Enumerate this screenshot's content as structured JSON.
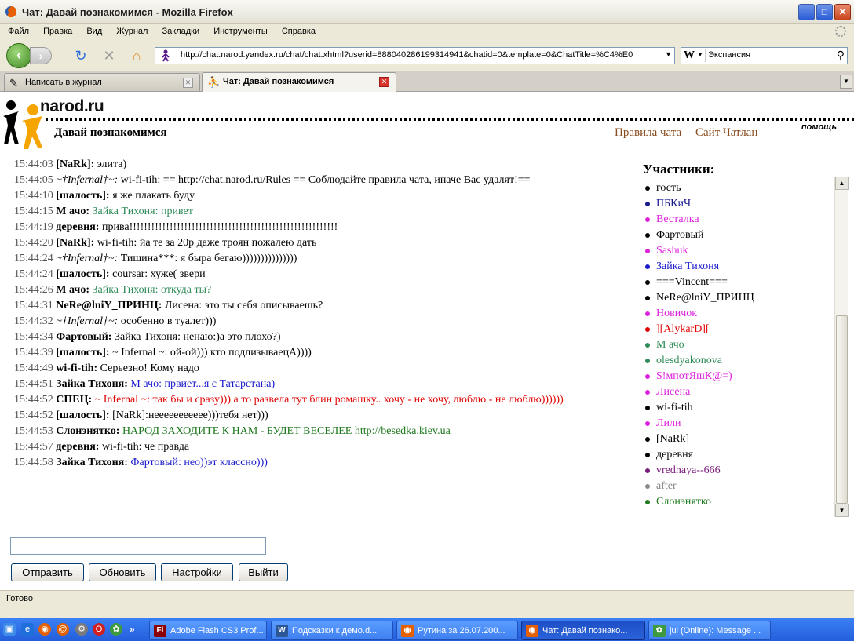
{
  "window": {
    "title": "Чат: Давай познакомимся - Mozilla Firefox"
  },
  "menu": [
    "Файл",
    "Правка",
    "Вид",
    "Журнал",
    "Закладки",
    "Инструменты",
    "Справка"
  ],
  "nav": {
    "url": "http://chat.narod.yandex.ru/chat/chat.xhtml?userid=888040286199314941&chatid=0&template=0&ChatTitle=%C4%E0",
    "search_engine": "W",
    "search_query": "Экспансия"
  },
  "tabs": [
    {
      "label": "Написать в журнал"
    },
    {
      "label": "Чат: Давай познакомимся"
    }
  ],
  "page": {
    "logo_text": "narod.ru",
    "help": "помощь",
    "room_title": "Давай познакомимся",
    "rules_link": "Правила чата",
    "site_link": "Сайт Чатлан",
    "participants_title": "Участники:"
  },
  "messages": [
    {
      "time": "15:44:03",
      "nick": "[NaRk]:",
      "text": " элита)",
      "color": "#000000"
    },
    {
      "time": "15:44:05",
      "nick": "~†Infernal†~:",
      "italic": true,
      "text": " wi-fi-tih: == http://chat.narod.ru/Rules == Соблюдайте правила чата, иначе Вас удалят!==",
      "color": "#000000"
    },
    {
      "time": "15:44:10",
      "nick": "[шалость]:",
      "text": " я же плакать буду",
      "color": "#000000"
    },
    {
      "time": "15:44:15",
      "nick": "М ачо:",
      "text": " Зайка Тихоня: привет",
      "color": "#2E8B57"
    },
    {
      "time": "15:44:19",
      "nick": "деревня:",
      "text": " прива!!!!!!!!!!!!!!!!!!!!!!!!!!!!!!!!!!!!!!!!!!!!!!!!!!!!!!!!!",
      "color": "#000000"
    },
    {
      "time": "15:44:20",
      "nick": "[NaRk]:",
      "text": " wi-fi-tih: йа те за 20р даже троян пожалею дать",
      "color": "#000000"
    },
    {
      "time": "15:44:24",
      "nick": "~†Infernal†~:",
      "italic": true,
      "text": " Тишина***: я быра бегаю)))))))))))))))",
      "color": "#000000"
    },
    {
      "time": "15:44:24",
      "nick": "[шалость]:",
      "text": " coursar: хуже( звери",
      "color": "#000000"
    },
    {
      "time": "15:44:26",
      "nick": "М ачо:",
      "text": " Зайка Тихоня: откуда ты?",
      "color": "#2E8B57"
    },
    {
      "time": "15:44:31",
      "nick": "NeRe@lniY_ПРИНЦ:",
      "text": " Лисена: это ты себя описываешь?",
      "color": "#000000"
    },
    {
      "time": "15:44:32",
      "nick": "~†Infernal†~:",
      "italic": true,
      "text": " особенно в туалет)))",
      "color": "#000000"
    },
    {
      "time": "15:44:34",
      "nick": "Фартовый:",
      "text": " Зайка Тихоня: ненаю:)а это плохо?)",
      "color": "#000000"
    },
    {
      "time": "15:44:39",
      "nick": "[шалость]:",
      "text": " ~ Infernal ~: ой-ой))) кто подлизываецА))))",
      "color": "#000000"
    },
    {
      "time": "15:44:49",
      "nick": "wi-fi-tih:",
      "text": " Серьезно! Кому надо",
      "color": "#000000"
    },
    {
      "time": "15:44:51",
      "nick": "Зайка Тихоня:",
      "text": " М ачо: првиет...я с Татарстана)",
      "color": "#1A1ACC"
    },
    {
      "time": "15:44:52",
      "nick": "СПЕЦ:",
      "text": " ~ Infernal ~: так бы и сразу))) а то развела тут блин ромашку.. хочу - не хочу, люблю - не люблю))))))",
      "color": "#E00000",
      "wrap": true
    },
    {
      "time": "15:44:52",
      "nick": "[шалость]:",
      "text": " [NaRk]:неееееееееее)))тебя нет)))",
      "color": "#000000"
    },
    {
      "time": "15:44:53",
      "nick": "Слонэнятко:",
      "text": " НАРОД ЗАХОДИТЕ К НАМ - БУДЕТ ВЕСЕЛЕЕ http://besedka.kiev.ua",
      "color": "#1E7A1E"
    },
    {
      "time": "15:44:57",
      "nick": "деревня:",
      "text": " wi-fi-tih: че правда",
      "color": "#000000"
    },
    {
      "time": "15:44:58",
      "nick": "Зайка Тихоня:",
      "text": " Фартовый: нео))эт классно)))",
      "color": "#1A1ACC"
    }
  ],
  "participants": [
    {
      "name": "гость",
      "color": "#000000"
    },
    {
      "name": "ПБКиЧ",
      "color": "#1A1A8C"
    },
    {
      "name": "Весталка",
      "color": "#DD22DD"
    },
    {
      "name": "Фартовый",
      "color": "#000000"
    },
    {
      "name": "Sashuk",
      "color": "#DD22DD"
    },
    {
      "name": "Зайка Тихоня",
      "color": "#1A1ACC"
    },
    {
      "name": "===Vincent===",
      "color": "#000000"
    },
    {
      "name": "NeRe@lniY_ПРИНЦ",
      "color": "#000000"
    },
    {
      "name": "Новичок",
      "color": "#DD22DD"
    },
    {
      "name": "][AlykarD][",
      "color": "#E00000"
    },
    {
      "name": "М ачо",
      "color": "#2E8B57"
    },
    {
      "name": "olesdyakonova",
      "color": "#2E8B57"
    },
    {
      "name": "S!мпотЯшК@=)",
      "color": "#DD22DD"
    },
    {
      "name": "Лисена",
      "color": "#DD22DD"
    },
    {
      "name": "wi-fi-tih",
      "color": "#000000"
    },
    {
      "name": "Лили",
      "color": "#DD22DD"
    },
    {
      "name": "[NaRk]",
      "color": "#000000"
    },
    {
      "name": "деревня",
      "color": "#000000"
    },
    {
      "name": "vrednaya--666",
      "color": "#7A1A7A"
    },
    {
      "name": "after",
      "color": "#888888"
    },
    {
      "name": "Слонэнятко",
      "color": "#1E7A1E"
    }
  ],
  "buttons": {
    "send": "Отправить",
    "refresh": "Обновить",
    "settings": "Настройки",
    "exit": "Выйти"
  },
  "status": "Готово",
  "taskbar": [
    {
      "label": "Adobe Flash CS3 Prof...",
      "icon": "Fl",
      "icon_bg": "#8B0000"
    },
    {
      "label": "Подсказки к демо.d...",
      "icon": "W",
      "icon_bg": "#2B5797"
    },
    {
      "label": "Рутина за 26.07.200...",
      "icon": "◉",
      "icon_bg": "#E66000"
    },
    {
      "label": "Чат: Давай познако...",
      "icon": "◉",
      "icon_bg": "#E66000"
    },
    {
      "label": "jul (Online): Message ...",
      "icon": "✿",
      "icon_bg": "#3E9A3E"
    }
  ]
}
